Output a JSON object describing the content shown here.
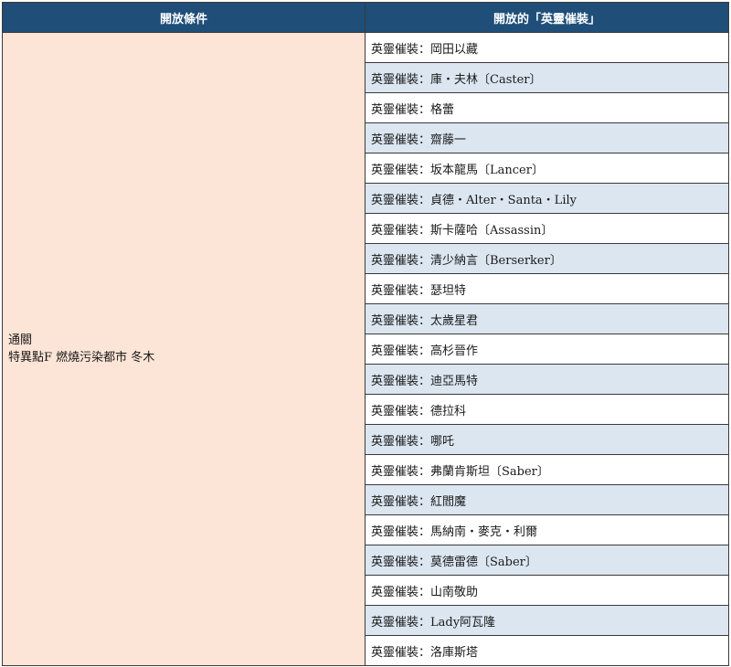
{
  "header": {
    "condition": "開放條件",
    "unlocked": "開放的「英靈催裝」"
  },
  "condition": {
    "line1": "通關",
    "line2": "特異點F 燃燒污染都市 冬木"
  },
  "crafts": [
    "英靈催裝：岡田以藏",
    "英靈催裝：庫・夫林〔Caster〕",
    "英靈催裝：格蕾",
    "英靈催裝：齋藤一",
    "英靈催裝：坂本龍馬〔Lancer〕",
    "英靈催裝：貞德・Alter・Santa・Lily",
    "英靈催裝：斯卡薩哈〔Assassin〕",
    "英靈催裝：清少納言〔Berserker〕",
    "英靈催裝：瑟坦特",
    "英靈催裝：太歲星君",
    "英靈催裝：高杉晉作",
    "英靈催裝：迪亞馬特",
    "英靈催裝：德拉科",
    "英靈催裝：哪吒",
    "英靈催裝：弗蘭肯斯坦〔Saber〕",
    "英靈催裝：紅閻魔",
    "英靈催裝：馬納南・麥克・利爾",
    "英靈催裝：莫德雷德〔Saber〕",
    "英靈催裝：山南敬助",
    "英靈催裝：Lady阿瓦隆",
    "英靈催裝：洛庫斯塔"
  ],
  "colors": {
    "header_bg": "#1f4e79",
    "condition_bg": "#fce4d6",
    "row_alt_bg": "#dce6f1",
    "row_bg": "#ffffff"
  }
}
